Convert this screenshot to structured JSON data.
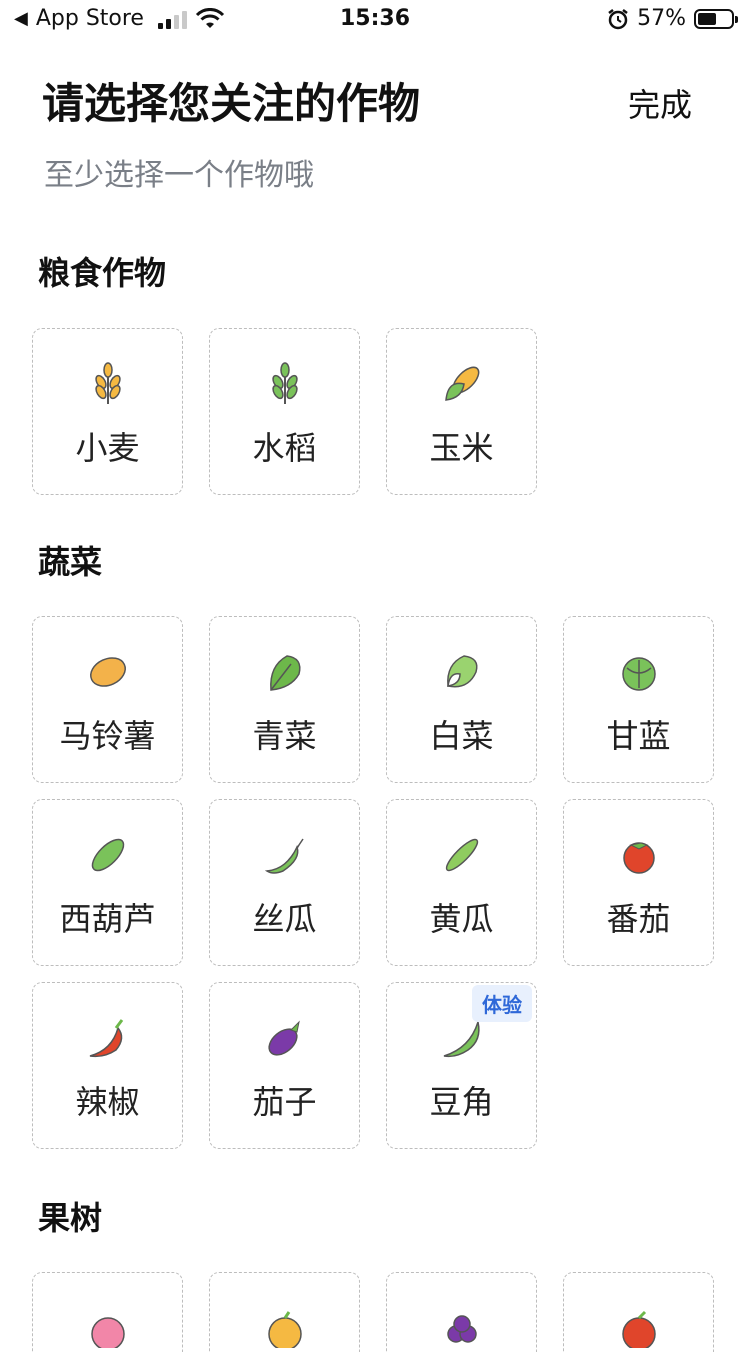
{
  "status_bar": {
    "carrier": "App Store",
    "time": "15:36",
    "battery": "57%",
    "battery_level": 0.57
  },
  "header": {
    "title": "请选择您关注的作物",
    "done_label": "完成",
    "subtitle": "至少选择一个作物哦"
  },
  "sections": {
    "grain": {
      "title": "粮食作物",
      "items": [
        {
          "label": "小麦",
          "icon": "wheat-icon"
        },
        {
          "label": "水稻",
          "icon": "rice-icon"
        },
        {
          "label": "玉米",
          "icon": "corn-icon"
        }
      ]
    },
    "vegetables": {
      "title": "蔬菜",
      "items": [
        {
          "label": "马铃薯",
          "icon": "potato-icon"
        },
        {
          "label": "青菜",
          "icon": "greens-icon"
        },
        {
          "label": "白菜",
          "icon": "cabbage-icon"
        },
        {
          "label": "甘蓝",
          "icon": "kale-icon"
        },
        {
          "label": "西葫芦",
          "icon": "zucchini-icon"
        },
        {
          "label": "丝瓜",
          "icon": "loofah-icon"
        },
        {
          "label": "黄瓜",
          "icon": "cucumber-icon"
        },
        {
          "label": "番茄",
          "icon": "tomato-icon"
        },
        {
          "label": "辣椒",
          "icon": "chili-icon"
        },
        {
          "label": "茄子",
          "icon": "eggplant-icon"
        },
        {
          "label": "豆角",
          "icon": "bean-icon",
          "badge": "体验"
        }
      ]
    },
    "fruit_trees": {
      "title": "果树",
      "items": [
        {
          "icon": "peach-icon"
        },
        {
          "icon": "orange-icon"
        },
        {
          "icon": "grape-icon"
        },
        {
          "icon": "apple-icon"
        }
      ]
    }
  },
  "colors": {
    "accent_badge_text": "#2f68d8",
    "accent_badge_bg": "#e8f0fd",
    "subtitle": "#7a7f87",
    "card_border": "#bdbdbd"
  }
}
